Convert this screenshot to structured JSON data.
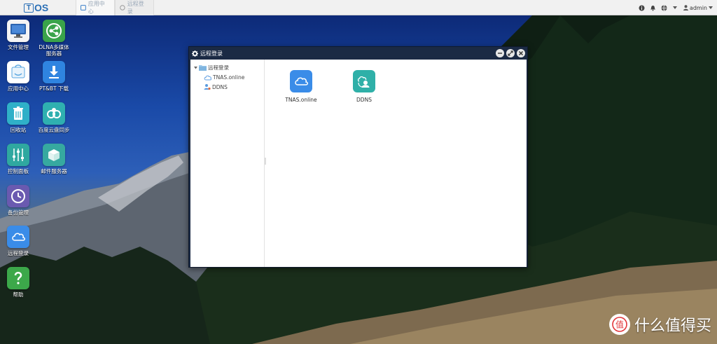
{
  "topbar": {
    "logo_letter": "T",
    "logo_text": "OS",
    "tabs": [
      {
        "label": "应用中心"
      },
      {
        "label": "远程登录"
      }
    ],
    "user": "admin"
  },
  "desktop": {
    "icons": [
      {
        "label": "文件管理",
        "icon": "monitor-icon",
        "color": "#2c64b0"
      },
      {
        "label": "DLNA多媒体服务器",
        "icon": "dlna-icon",
        "color": "#3aa34a"
      },
      {
        "label": "应用中心",
        "icon": "app-store-icon",
        "color": "#ffffff"
      },
      {
        "label": "PT&BT 下载",
        "icon": "download-icon",
        "color": "#2f84e0"
      },
      {
        "label": "回收站",
        "icon": "trash-icon",
        "color": "#2fb0c8"
      },
      {
        "label": "百度云盘同步",
        "icon": "baidu-sync-icon",
        "color": "#2fb0b0"
      },
      {
        "label": "控制面板",
        "icon": "sliders-icon",
        "color": "#2fa8a0"
      },
      {
        "label": "邮件服务器",
        "icon": "mail-server-icon",
        "color": "#36a9a0"
      },
      {
        "label": "备份管理",
        "icon": "clock-icon",
        "color": "#6a5ab0"
      },
      {
        "label": "远程登录",
        "icon": "cloud-icon",
        "color": "#3a8ce8"
      },
      {
        "label": "帮助",
        "icon": "help-icon",
        "color": "#3ca84a"
      }
    ]
  },
  "window": {
    "title": "远程登录",
    "tree": {
      "root": "远程登录",
      "children": [
        "TNAS.online",
        "DDNS"
      ]
    },
    "apps": [
      {
        "label": "TNAS.online",
        "icon": "cloud-icon",
        "color": "#3a8ce8"
      },
      {
        "label": "DDNS",
        "icon": "ddns-icon",
        "color": "#2fb0a8"
      }
    ]
  },
  "watermark": {
    "badge": "值",
    "text": "什么值得买"
  }
}
